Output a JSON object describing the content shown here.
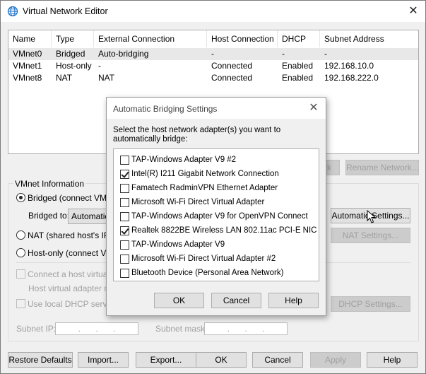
{
  "window": {
    "title": "Virtual Network Editor",
    "close_glyph": "✕",
    "icon": "globe-icon"
  },
  "table": {
    "headers": [
      "Name",
      "Type",
      "External Connection",
      "Host Connection",
      "DHCP",
      "Subnet Address"
    ],
    "rows": [
      [
        "VMnet0",
        "Bridged",
        "Auto-bridging",
        "-",
        "-",
        "-"
      ],
      [
        "VMnet1",
        "Host-only",
        "-",
        "Connected",
        "Enabled",
        "192.168.10.0"
      ],
      [
        "VMnet8",
        "NAT",
        "NAT",
        "Connected",
        "Enabled",
        "192.168.222.0"
      ]
    ]
  },
  "mid_buttons": {
    "add_partial": "k",
    "rename": "Rename Network..."
  },
  "vmnet_info": {
    "label": "VMnet Information",
    "bridged": "Bridged (connect VMs di",
    "bridged_to_label": "Bridged to:",
    "bridged_to_value": "Automatic",
    "auto_settings": "Automatic Settings...",
    "nat": "NAT (shared host's IP a",
    "nat_settings": "NAT Settings...",
    "host_only": "Host-only (connect VMs",
    "connect_host_adapter": "Connect a host virtual a",
    "host_adapter_name": "Host virtual adapter na",
    "use_dhcp": "Use local DHCP service",
    "dhcp_settings": "DHCP Settings...",
    "subnet_ip_label": "Subnet IP:",
    "subnet_ip_value": ". . .",
    "subnet_mask_label": "Subnet mask:",
    "subnet_mask_value": ". . ."
  },
  "footer": {
    "restore": "Restore Defaults",
    "import": "Import...",
    "export": "Export...",
    "ok": "OK",
    "cancel": "Cancel",
    "apply": "Apply",
    "help": "Help"
  },
  "dialog": {
    "title": "Automatic Bridging Settings",
    "close_glyph": "✕",
    "prompt": "Select the host network adapter(s) you want to automatically bridge:",
    "adapters": [
      {
        "label": "TAP-Windows Adapter V9 #2",
        "checked": false
      },
      {
        "label": "Intel(R) I211 Gigabit Network Connection",
        "checked": true
      },
      {
        "label": "Famatech RadminVPN Ethernet Adapter",
        "checked": false
      },
      {
        "label": "Microsoft Wi-Fi Direct Virtual Adapter",
        "checked": false
      },
      {
        "label": "TAP-Windows Adapter V9 for OpenVPN Connect",
        "checked": false
      },
      {
        "label": "Realtek 8822BE Wireless LAN 802.11ac PCI-E NIC",
        "checked": true
      },
      {
        "label": "TAP-Windows Adapter V9",
        "checked": false
      },
      {
        "label": "Microsoft Wi-Fi Direct Virtual Adapter #2",
        "checked": false
      },
      {
        "label": "Bluetooth Device (Personal Area Network)",
        "checked": false
      }
    ],
    "ok": "OK",
    "cancel": "Cancel",
    "help": "Help"
  }
}
